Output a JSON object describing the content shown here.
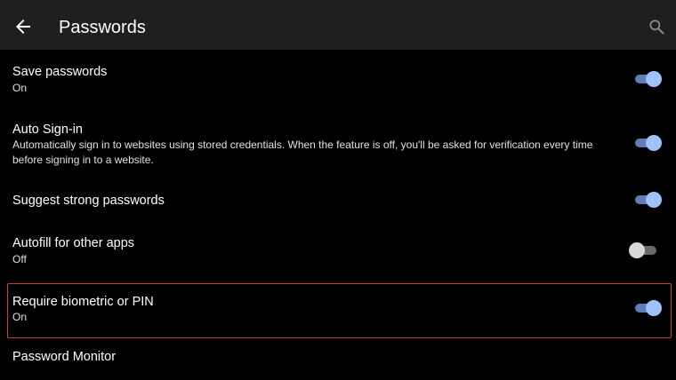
{
  "header": {
    "title": "Passwords",
    "back_icon": "back-arrow-icon",
    "search_icon": "search-icon"
  },
  "settings": [
    {
      "title": "Save passwords",
      "subtitle": "On",
      "enabled": true
    },
    {
      "title": "Auto Sign-in",
      "subtitle": "Automatically sign in to websites using stored credentials. When the feature is off, you'll be asked for verification every time before signing in to a website.",
      "enabled": true
    },
    {
      "title": "Suggest strong passwords",
      "subtitle": "",
      "enabled": true
    },
    {
      "title": "Autofill for other apps",
      "subtitle": "Off",
      "enabled": false
    },
    {
      "title": "Require biometric or PIN",
      "subtitle": "On",
      "enabled": true,
      "highlighted": true
    },
    {
      "title": "Password Monitor"
    }
  ],
  "colors": {
    "appbar": "#1f1f1f",
    "toggle_on_thumb": "#9fc2fa",
    "toggle_on_track": "#5f7eb8",
    "highlight_border": "#d23b3b"
  }
}
